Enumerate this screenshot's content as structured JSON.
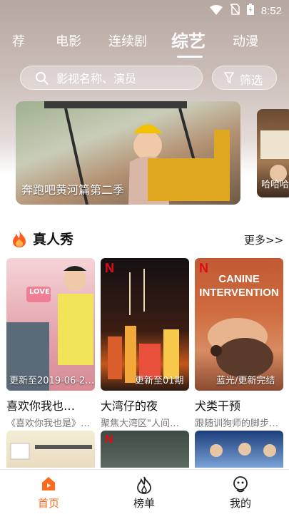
{
  "status_bar": {
    "time": "8:52"
  },
  "tabs": [
    {
      "label": "荐"
    },
    {
      "label": "电影"
    },
    {
      "label": "连续剧"
    },
    {
      "label": "综艺",
      "active": true
    },
    {
      "label": "动漫"
    }
  ],
  "search": {
    "placeholder": "影视名称、演员",
    "filter_label": "筛选"
  },
  "banners": [
    {
      "caption": "奔跑吧黄河篇第二季"
    },
    {
      "caption": "哈哈哈"
    }
  ],
  "section": {
    "title": "真人秀",
    "more": "更多>>"
  },
  "cards": [
    {
      "episode": "更新至2019-06-2…",
      "title": "喜欢你我也…",
      "subtitle": "《喜欢你我也是》…",
      "poster_badge": "LOVE"
    },
    {
      "episode": "更新至01期",
      "title": "大湾仔的夜",
      "subtitle": "聚焦大湾区\"人间…",
      "poster_badge": "N"
    },
    {
      "episode": "蓝光/更新完结",
      "title": "犬类干预",
      "subtitle": "跟随训狗师的脚步…",
      "poster_badge": "N",
      "poster_text": "CANINE INTERVENTION"
    }
  ],
  "bottom_nav": [
    {
      "label": "首页",
      "icon": "home-icon",
      "active": true
    },
    {
      "label": "榜单",
      "icon": "flame-outline-icon"
    },
    {
      "label": "我的",
      "icon": "profile-icon"
    }
  ],
  "colors": {
    "accent": "#ff6a1f",
    "netflix_red": "#e50914"
  }
}
